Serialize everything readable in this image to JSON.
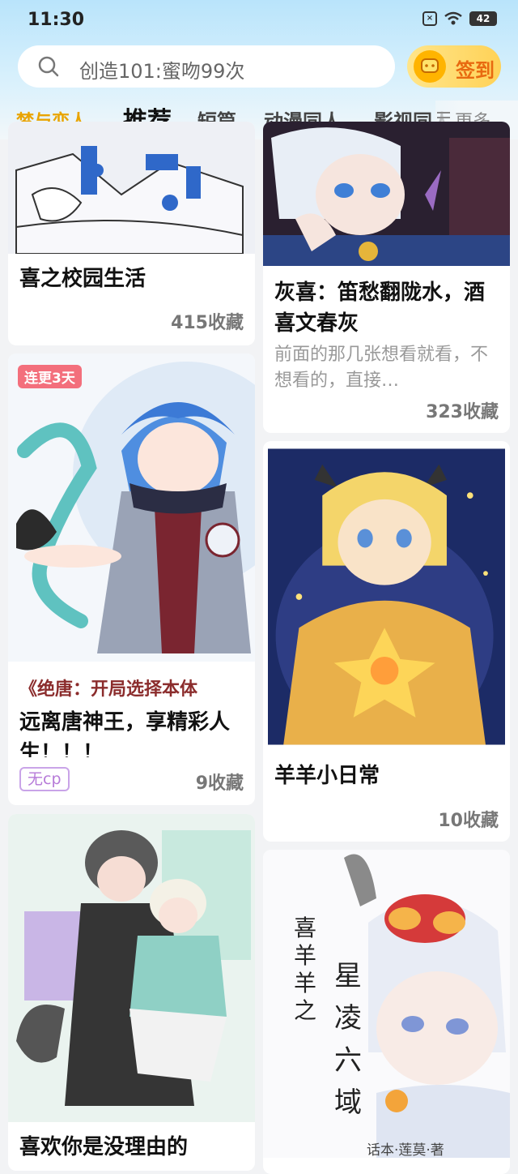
{
  "status_bar": {
    "time": "11:30",
    "battery": "42"
  },
  "search": {
    "placeholder": "创造101:蜜吻99次"
  },
  "signin": {
    "label": "签到"
  },
  "tabs": [
    "梦与恋人",
    "推荐",
    "短篇",
    "动漫同人",
    "影视同人"
  ],
  "more_label": "更多",
  "cards": [
    {
      "title": "喜之校园生活",
      "count": "415收藏"
    },
    {
      "title": "灰喜：笛愁翻陇水，酒喜文春灰",
      "desc": "前面的那几张想看就看，不想看的，直接…",
      "count": "323收藏"
    },
    {
      "badge": "连更3天",
      "subtitle": "《绝唐：开局选择本体",
      "title": "远离唐神王，享精彩人生！！！",
      "tag": "无cp",
      "count": "9收藏"
    },
    {
      "title": "羊羊小日常",
      "count": "10收藏"
    },
    {
      "title": "喜欢你是没理由的"
    },
    {
      "cover_text": [
        "喜羊羊之",
        "星凌六域"
      ],
      "cover_credit": "话本·莲莫·著"
    }
  ]
}
